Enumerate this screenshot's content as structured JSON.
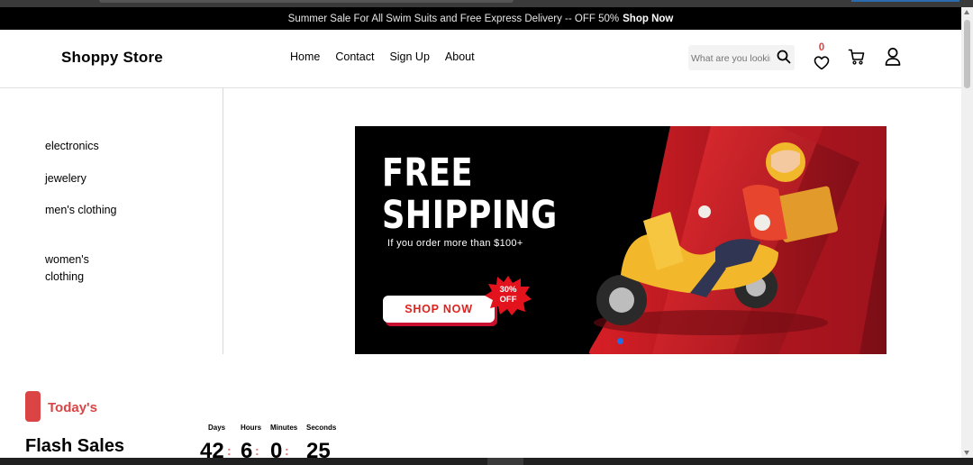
{
  "promo": {
    "message": "Summer Sale For All Swim Suits and Free Express Delivery -- OFF 50%",
    "link": "Shop Now"
  },
  "header": {
    "logo": "Shoppy Store",
    "nav": [
      "Home",
      "Contact",
      "Sign Up",
      "About"
    ],
    "search_placeholder": "What are you looking for?",
    "wishlist_count": "0"
  },
  "sidebar": {
    "categories": [
      "electronics",
      "jewelery",
      "men's clothing",
      "women's clothing"
    ]
  },
  "banner": {
    "headline_line1": "FREE",
    "headline_line2": "SHIPPING",
    "subtext": "If you order more than $100+",
    "button": "SHOP NOW",
    "badge": "30% OFF",
    "badge_line1": "30%",
    "badge_line2": "OFF"
  },
  "flash": {
    "section_label": "Today's",
    "title": "Flash Sales",
    "countdown": [
      {
        "label": "Days",
        "value": "42"
      },
      {
        "label": "Hours",
        "value": "6"
      },
      {
        "label": "Minutes",
        "value": "0"
      },
      {
        "label": "Seconds",
        "value": "25"
      }
    ]
  },
  "colors": {
    "accent": "#db4444",
    "topbar": "#000000",
    "carousel_dot": "#1e6fe8"
  },
  "icons": [
    "search-icon",
    "heart-icon",
    "cart-icon",
    "user-icon"
  ]
}
